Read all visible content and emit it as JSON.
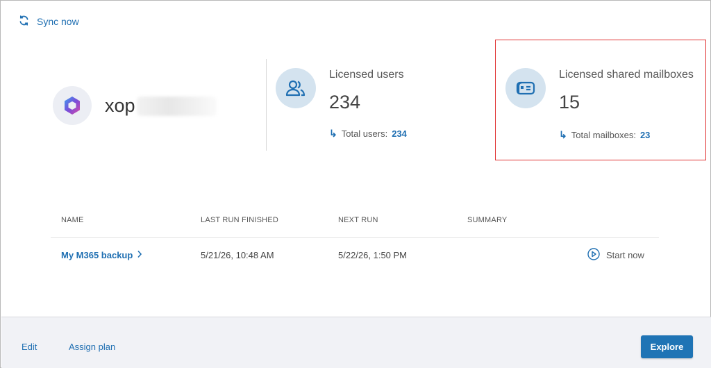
{
  "header": {
    "sync_label": "Sync now"
  },
  "tenant": {
    "name_prefix": "xop"
  },
  "stats": {
    "users": {
      "title": "Licensed users",
      "value": "234",
      "sub_label": "Total users:",
      "sub_value": "234"
    },
    "mailboxes": {
      "title": "Licensed shared mailboxes",
      "value": "15",
      "sub_label": "Total mailboxes:",
      "sub_value": "23"
    }
  },
  "table": {
    "columns": [
      "NAME",
      "LAST RUN FINISHED",
      "NEXT RUN",
      "SUMMARY"
    ],
    "rows": [
      {
        "name": "My M365 backup",
        "last_run": "5/21/26, 10:48 AM",
        "next_run": "5/22/26, 1:50 PM",
        "summary": "",
        "action": "Start now"
      }
    ]
  },
  "footer": {
    "edit_label": "Edit",
    "assign_label": "Assign plan",
    "explore_label": "Explore"
  },
  "colors": {
    "accent": "#1f74b5",
    "link": "#1f6fb2",
    "highlight": "#e03030",
    "icon_bg": "#d4e3ef"
  }
}
